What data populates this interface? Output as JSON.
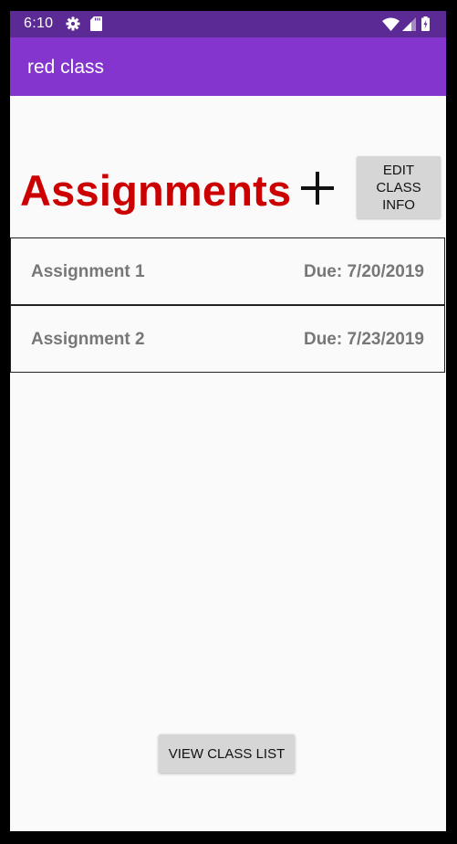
{
  "status_bar": {
    "time": "6:10",
    "icons": [
      "gear-icon",
      "sd-card-icon",
      "wifi-icon",
      "signal-icon",
      "battery-icon"
    ]
  },
  "app_bar": {
    "title": "red class"
  },
  "main": {
    "heading": "Assignments",
    "add_icon": "plus-icon",
    "edit_button": "EDIT CLASS INFO",
    "assignments": [
      {
        "name": "Assignment 1",
        "due": "Due: 7/20/2019"
      },
      {
        "name": "Assignment 2",
        "due": "Due: 7/23/2019"
      }
    ],
    "view_button": "VIEW CLASS LIST"
  },
  "colors": {
    "status_bar": "#5b2a94",
    "app_bar": "#8435cd",
    "heading": "#cc0000",
    "row_text": "#777777",
    "button_bg": "#d6d6d6"
  }
}
